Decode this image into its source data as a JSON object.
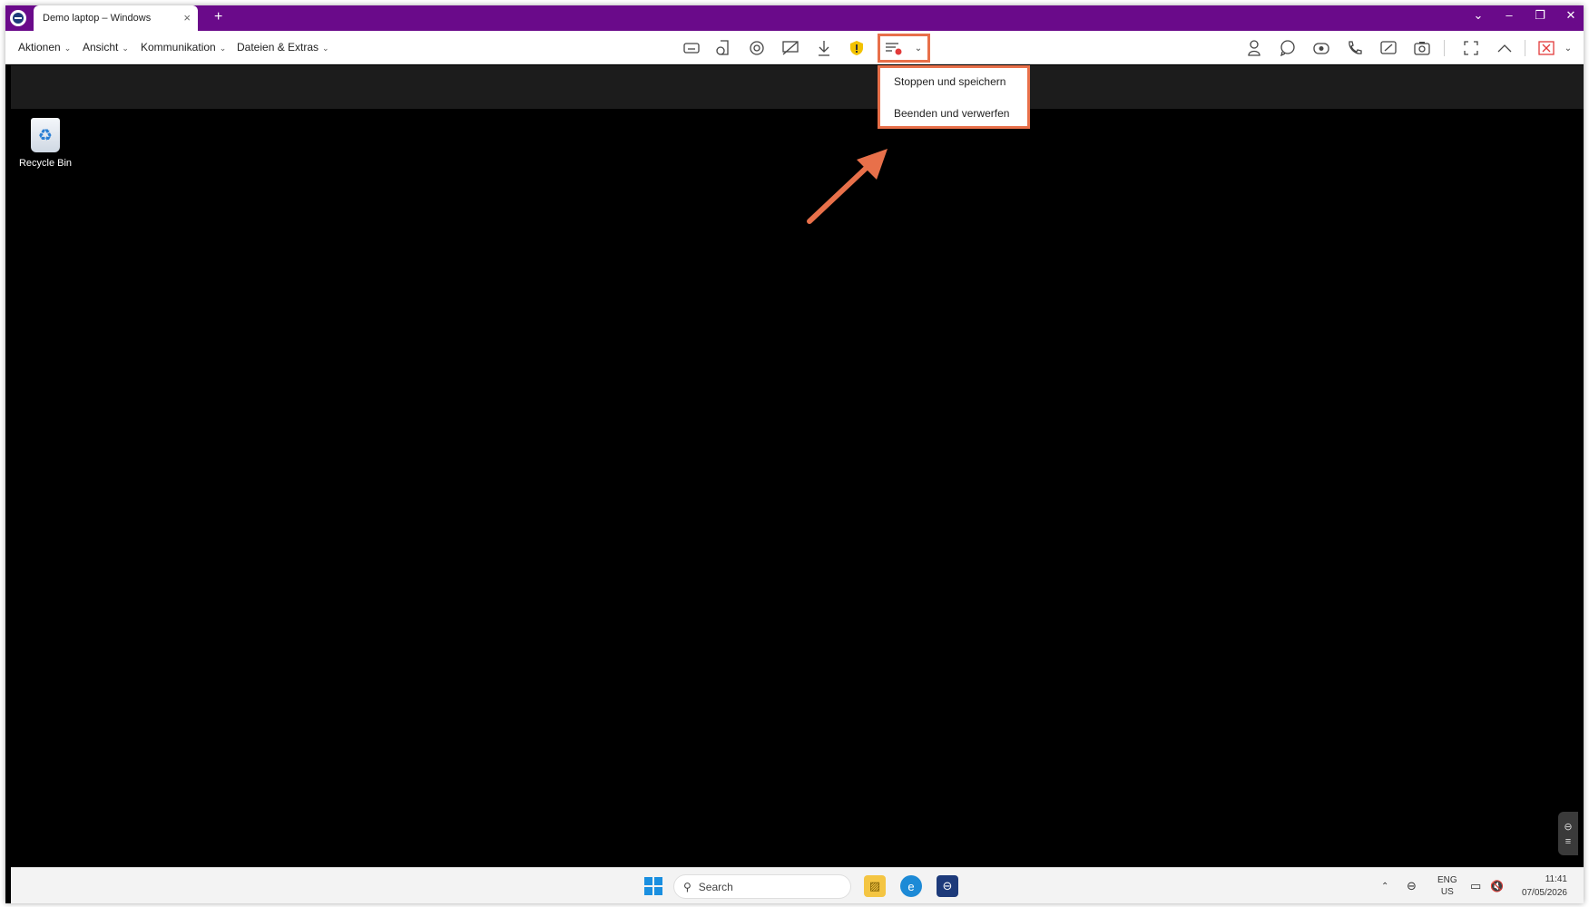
{
  "window": {
    "tab_title": "Demo laptop – Windows",
    "tab_close": "×",
    "tab_add": "+",
    "controls": [
      "⌄",
      "–",
      "❐",
      "✕"
    ]
  },
  "toolbar": {
    "menus": [
      {
        "label": "Aktionen",
        "icon": "chevron-down-icon"
      },
      {
        "label": "Ansicht",
        "icon": "chevron-down-icon"
      },
      {
        "label": "Kommunikation",
        "icon": "chevron-down-icon"
      },
      {
        "label": "Dateien & Extras",
        "icon": "chevron-down-icon"
      }
    ],
    "center_icons": [
      "keyboard-icon",
      "remote-lock-icon",
      "refresh-icon",
      "block-input-icon",
      "download-icon",
      "shield-icon",
      "record-icon",
      "record-dropdown-icon"
    ],
    "right_icons": [
      "user-icon",
      "chat-icon",
      "video-icon",
      "call-icon",
      "whiteboard-icon",
      "screenshot-icon",
      "fullscreen-icon",
      "collapse-icon",
      "end-session-icon",
      "more-icon"
    ],
    "shield_color": "#f2c200",
    "accent_color": "#e8704a"
  },
  "dropdown": {
    "items": [
      "Stoppen und speichern",
      "Beenden und verwerfen"
    ]
  },
  "desktop": {
    "recycle_bin_label": "Recycle Bin"
  },
  "taskbar": {
    "search_placeholder": "Search",
    "lang_line1": "ENG",
    "lang_line2": "US",
    "time": "11:41",
    "date": "07/05/2026"
  },
  "colors": {
    "titlebar": "#6a0a8a",
    "highlight": "#e8704a"
  }
}
